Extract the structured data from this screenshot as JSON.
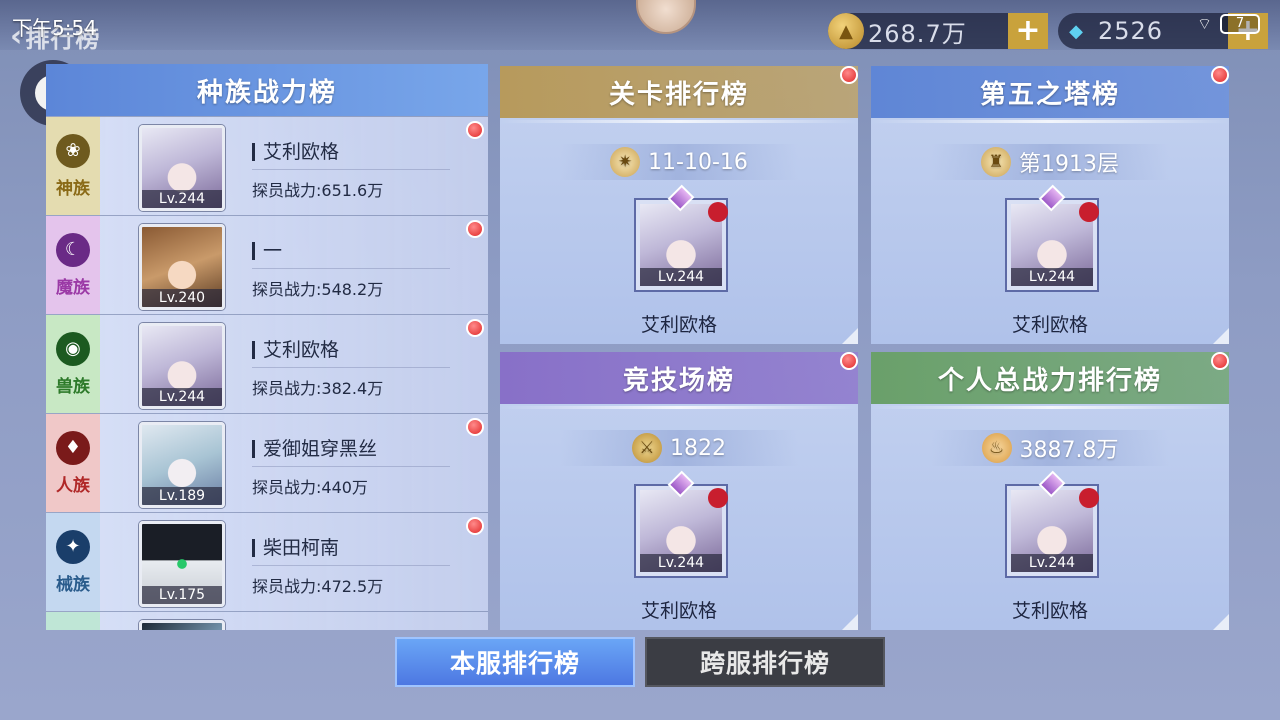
{
  "status_bar": {
    "time": "下午5:54",
    "battery": "7"
  },
  "header": {
    "back_label": "排行榜"
  },
  "currencies": [
    {
      "icon": "gold-coin-icon",
      "value": "268.7万"
    },
    {
      "icon": "diamond-icon",
      "value": "2526"
    }
  ],
  "race_panel": {
    "title": "种族战力榜",
    "rows": [
      {
        "race": "神族",
        "race_color": "#8a6a16",
        "icon": "lotus-icon",
        "name": "艾利欧格",
        "power": "探员战力:651.6万",
        "lv": "Lv.244",
        "art": "white-hair"
      },
      {
        "race": "魔族",
        "race_color": "#9b3aa6",
        "icon": "demon-icon",
        "name": "一",
        "power": "探员战力:548.2万",
        "lv": "Lv.240",
        "art": "brown-hair"
      },
      {
        "race": "兽族",
        "race_color": "#2d7a2a",
        "icon": "beast-icon",
        "name": "艾利欧格",
        "power": "探员战力:382.4万",
        "lv": "Lv.244",
        "art": "white-hair"
      },
      {
        "race": "人族",
        "race_color": "#b02828",
        "icon": "human-icon",
        "name": "爱御姐穿黑丝",
        "power": "探员战力:440万",
        "lv": "Lv.189",
        "art": "silver-hair"
      },
      {
        "race": "械族",
        "race_color": "#2a5c8c",
        "icon": "mech-icon",
        "name": "柴田柯南",
        "power": "探员战力:472.5万",
        "lv": "Lv.175",
        "art": "robot"
      }
    ]
  },
  "cards": [
    {
      "title": "关卡排行榜",
      "stat": "11-10-16",
      "stat_icon": "star-burst-icon",
      "name": "艾利欧格",
      "lv": "Lv.244",
      "head_color": "#b79a5c"
    },
    {
      "title": "第五之塔榜",
      "stat": "第1913层",
      "stat_icon": "tower-icon",
      "name": "艾利欧格",
      "lv": "Lv.244",
      "head_color": "#5f86d6"
    },
    {
      "title": "竞技场榜",
      "stat": "1822",
      "stat_icon": "swords-icon",
      "name": "艾利欧格",
      "lv": "Lv.244",
      "head_color": "#8870c8"
    },
    {
      "title": "个人总战力排行榜",
      "stat": "3887.8万",
      "stat_icon": "flame-icon",
      "name": "艾利欧格",
      "lv": "Lv.244",
      "head_color": "#6aa06a"
    }
  ],
  "tabs": {
    "local": "本服排行榜",
    "cross": "跨服排行榜"
  }
}
